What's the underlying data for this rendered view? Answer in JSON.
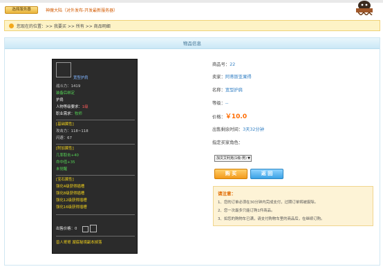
{
  "header": {
    "server_button": "选择服务器",
    "server_name": "神魔大陆（对外发布-开发最新服务器）"
  },
  "breadcrumb": "您现在的位置：>> 我要买 >> 所有 >> 商品明细",
  "panel": {
    "title": "物品信息"
  },
  "item_card": {
    "name": "宽型护肩",
    "battle_power": "战斗力：1419",
    "bind_status": "装备后绑定",
    "slot_type": "护肩",
    "level_req_label": "人物等级要求：",
    "level_req_value": "1级",
    "class_req_label": "职业需求：",
    "class_req_value": "牧师",
    "base_attr_title": "[基础属性]",
    "attack": "攻击力：118~118",
    "dodge": "闪避：67",
    "extra_attr_title": "[附加属性]",
    "extra_1": "几率取击+40",
    "extra_2": "命中值+35",
    "extra_3": "未觉醒",
    "gem_attr_title": "[宝石属性]",
    "gem_1": "强化4级获得插槽",
    "gem_2": "强化8级获得插槽",
    "gem_3": "强化12级获得插槽",
    "gem_4": "强化16级获得插槽",
    "sell_price_label": "出售价格：0",
    "drop_source": "兽人哥哥 湖底秘境副本掉落"
  },
  "details": {
    "item_no_label": "商品号：",
    "item_no_value": "22",
    "seller_label": "卖家：",
    "seller_value": "阿蒂斯亚果得",
    "name_label": "名称：",
    "name_value": "宽型护肩",
    "grade_label": "等级：",
    "grade_value": "--",
    "price_label": "价格：",
    "price_value": "￥10.0",
    "remaining_label": "出售剩余时间：",
    "remaining_value": "3天32分钟",
    "buyer_role_label": "指定买家角色：",
    "role_select_value": "加文艾利克(1级-男)"
  },
  "actions": {
    "buy_label": "购 买",
    "back_label": "返 回"
  },
  "notice": {
    "title": "请注意：",
    "items": [
      "1、您的订单必须在30分钟内完成支付，过期订单将被废除。",
      "2、您一次最多只能订购1件商品。",
      "3、如您的购物车已满，请支付购物车里的商品后，在继续订购。"
    ]
  },
  "colors": {
    "accent_orange": "#ff6c00",
    "link_blue": "#2d7cc2",
    "card_bg": "#2b2b2b"
  }
}
